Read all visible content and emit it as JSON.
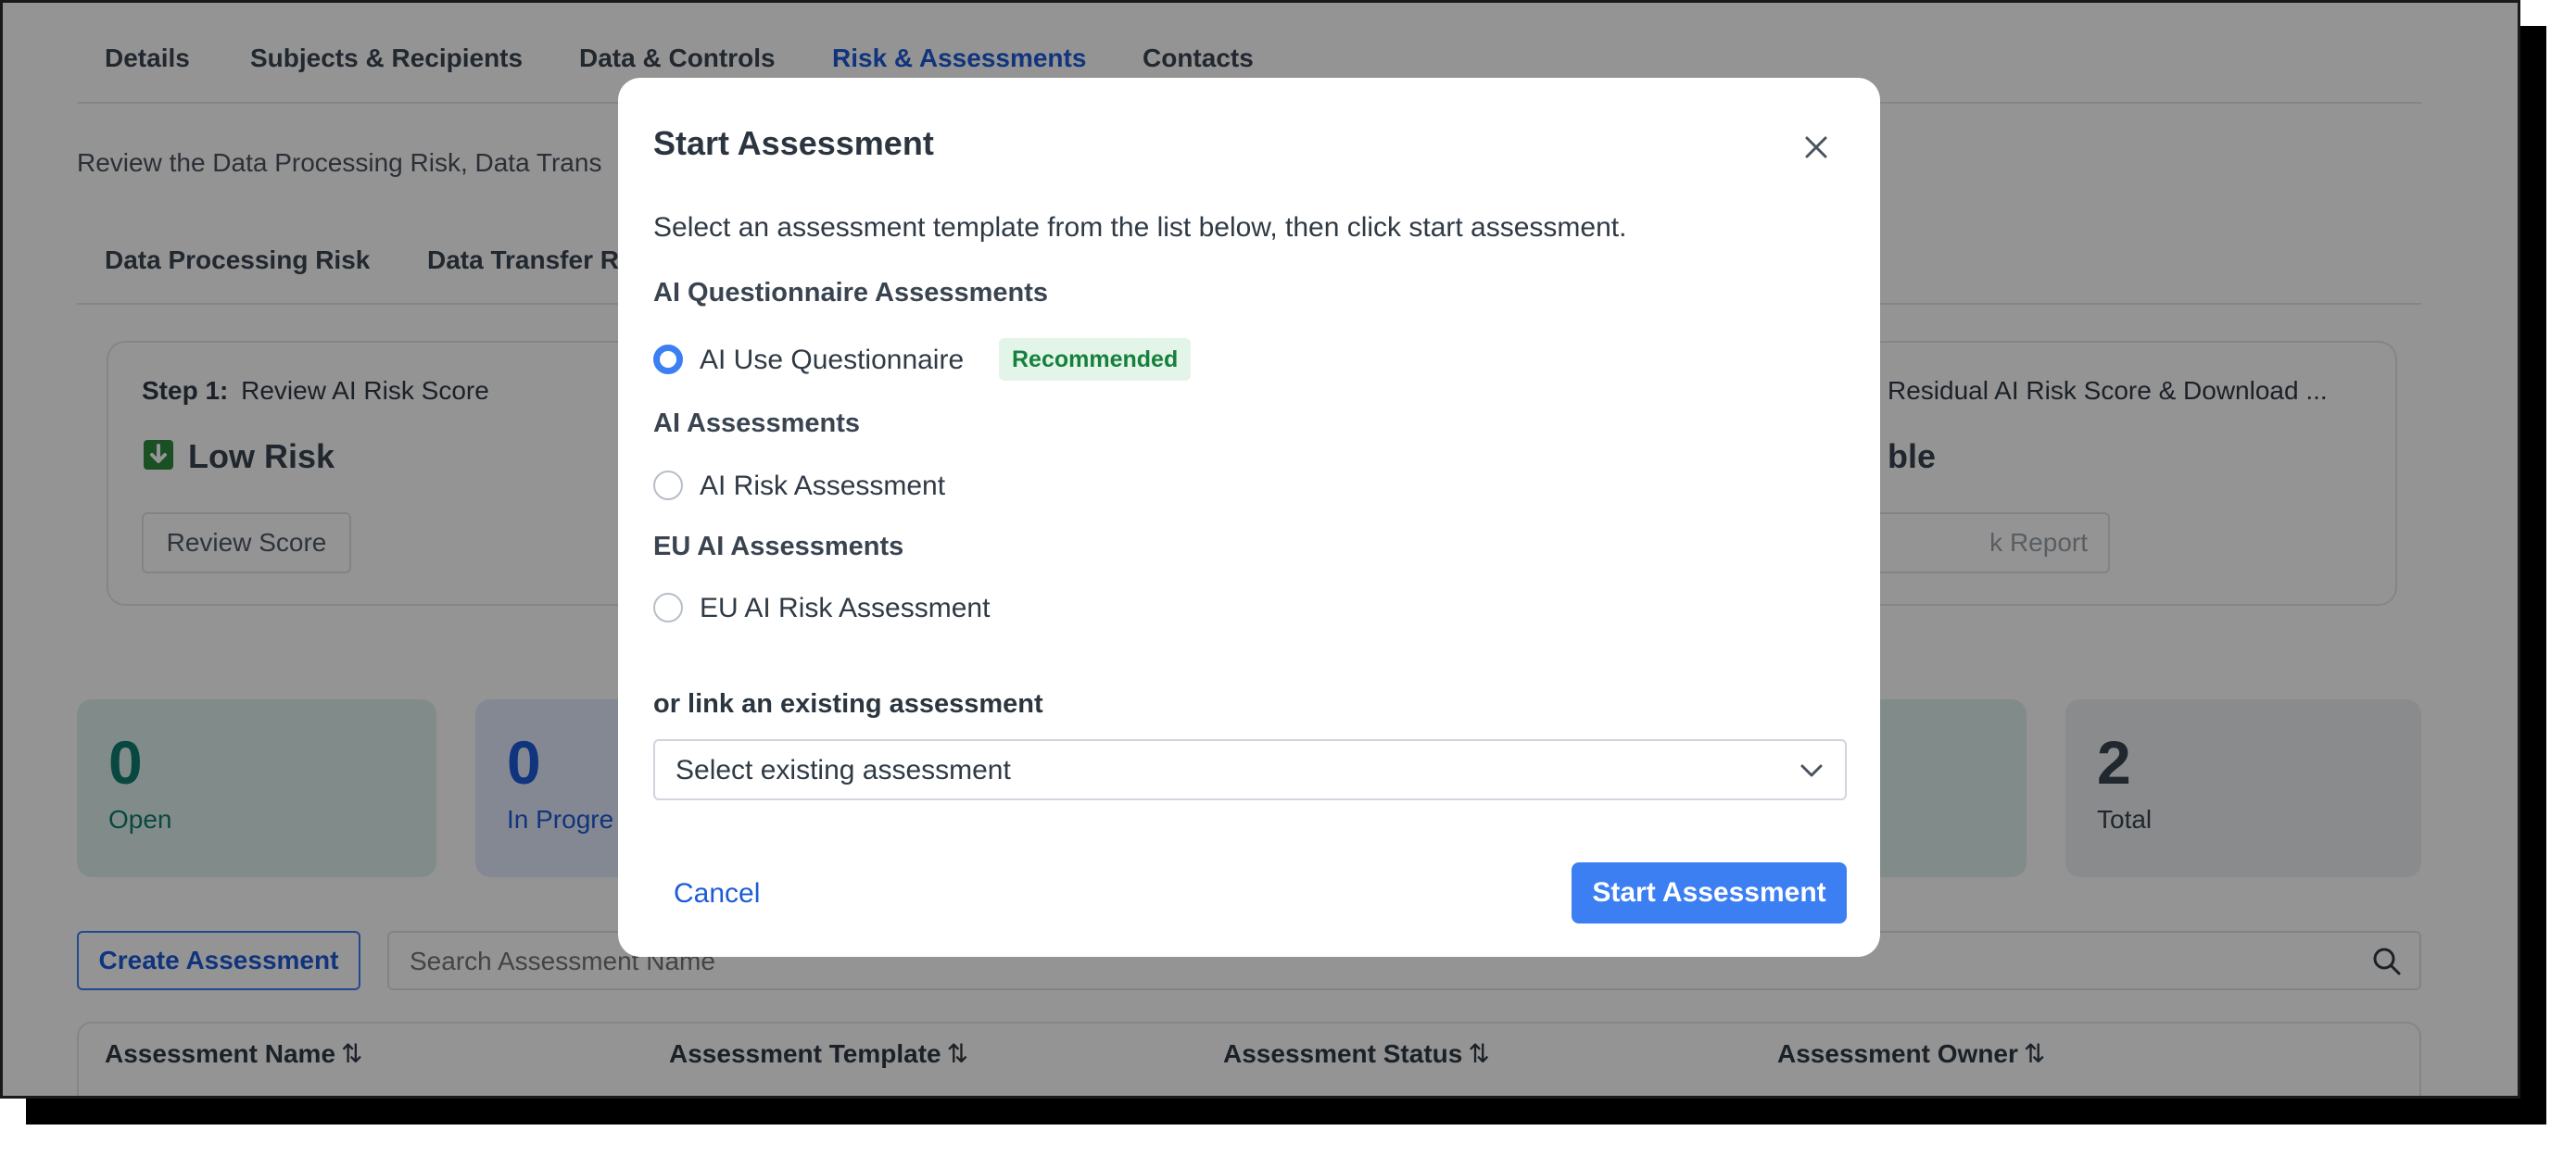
{
  "tabs": [
    "Details",
    "Subjects & Recipients",
    "Data & Controls",
    "Risk & Assessments",
    "Contacts"
  ],
  "active_tab": "Risk & Assessments",
  "intro_text": "Review the Data Processing Risk, Data Trans",
  "subtabs": [
    "Data Processing Risk",
    "Data Transfer R"
  ],
  "step1": {
    "step_label": "Step 1:",
    "title": "Review AI Risk Score",
    "risk_level": "Low Risk",
    "button": "Review Score"
  },
  "step3": {
    "title": "Residual AI Risk Score & Download ...",
    "value_fragment": "ble",
    "button_fragment": "k Report"
  },
  "stats": [
    {
      "value": "0",
      "label": "Open"
    },
    {
      "value": "0",
      "label": "In Progre"
    },
    {
      "value": "2",
      "label": "Total"
    }
  ],
  "create_button": "Create Assessment",
  "search_placeholder": "Search Assessment Name",
  "table_headers": [
    "Assessment Name",
    "Assessment Template",
    "Assessment Status",
    "Assessment Owner"
  ],
  "modal": {
    "title": "Start Assessment",
    "instructions": "Select an assessment template from the list below, then click start assessment.",
    "groups": [
      {
        "label": "AI Questionnaire Assessments",
        "options": [
          {
            "label": "AI Use Questionnaire",
            "badge": "Recommended",
            "selected": true
          }
        ]
      },
      {
        "label": "AI Assessments",
        "options": [
          {
            "label": "AI Risk Assessment",
            "selected": false
          }
        ]
      },
      {
        "label": "EU AI Assessments",
        "options": [
          {
            "label": "EU AI Risk Assessment",
            "selected": false
          }
        ]
      }
    ],
    "link_label": "or link an existing assessment",
    "select_value": "Select existing assessment",
    "cancel": "Cancel",
    "start": "Start Assessment"
  },
  "colors": {
    "accent": "#3b7ff3",
    "link": "#1d5bd8",
    "badge_bg": "#e3f5e8",
    "badge_text": "#17803d",
    "open_green": "#0f7d6e",
    "in_progress_blue": "#1d5bd8"
  }
}
